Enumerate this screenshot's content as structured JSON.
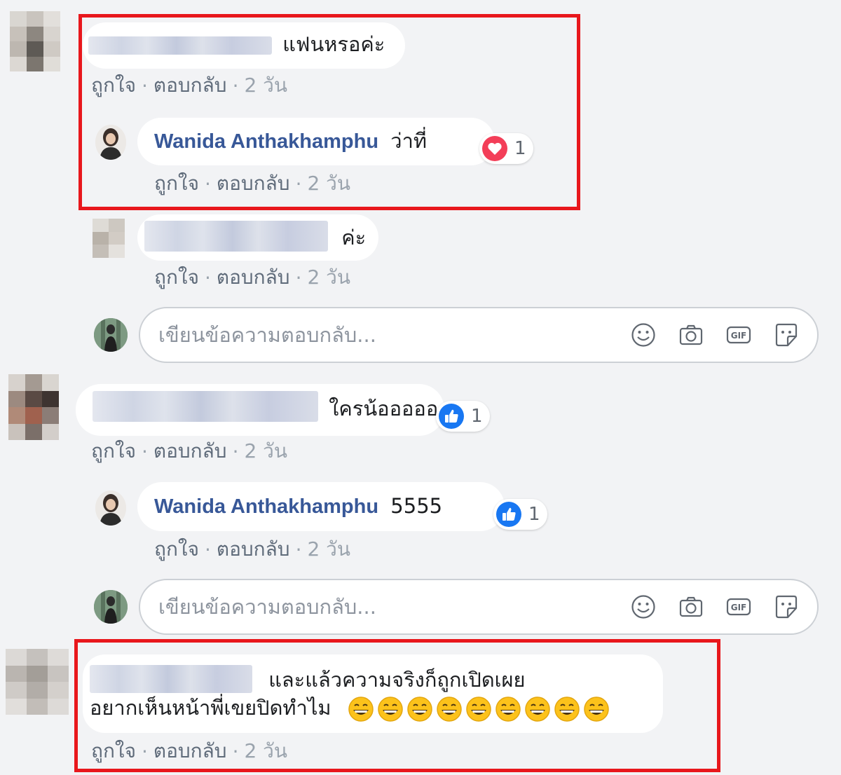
{
  "comments": [
    {
      "text": "แฟนหรอค่ะ",
      "actions": {
        "like": "ถูกใจ",
        "reply": "ตอบกลับ",
        "time": "2 วัน"
      }
    },
    {
      "author": "Wanida Anthakhamphu",
      "text": "ว่าที่",
      "reaction": {
        "type": "heart",
        "count": "1"
      },
      "actions": {
        "like": "ถูกใจ",
        "reply": "ตอบกลับ",
        "time": "2 วัน"
      }
    },
    {
      "text": "ค่ะ",
      "actions": {
        "like": "ถูกใจ",
        "reply": "ตอบกลับ",
        "time": "2 วัน"
      }
    },
    {
      "text": "ใครน้อออออ",
      "reaction": {
        "type": "like",
        "count": "1"
      },
      "actions": {
        "like": "ถูกใจ",
        "reply": "ตอบกลับ",
        "time": "2 วัน"
      }
    },
    {
      "author": "Wanida Anthakhamphu",
      "text": "5555",
      "reaction": {
        "type": "like",
        "count": "1"
      },
      "actions": {
        "like": "ถูกใจ",
        "reply": "ตอบกลับ",
        "time": "2 วัน"
      }
    },
    {
      "text_line1": "และแล้วความจริงก็ถูกเปิดเผย",
      "text_line2": "อยากเห็นหน้าพี่เขยปิดทำไม",
      "emoji": "grinning-face",
      "emoji_count": 9,
      "actions": {
        "like": "ถูกใจ",
        "reply": "ตอบกลับ",
        "time": "2 วัน"
      }
    }
  ],
  "reply_inputs": [
    {
      "placeholder": "เขียนข้อความตอบกลับ...",
      "icons": [
        "smiley-icon",
        "camera-icon",
        "gif-icon",
        "sticker-icon"
      ]
    },
    {
      "placeholder": "เขียนข้อความตอบกลับ...",
      "icons": [
        "smiley-icon",
        "camera-icon",
        "gif-icon",
        "sticker-icon"
      ]
    }
  ],
  "colors": {
    "background": "#f2f3f5",
    "name_link": "#385898",
    "highlight_box": "#e8171c",
    "heart_reaction": "#f33e58",
    "like_reaction": "#1877f2"
  }
}
